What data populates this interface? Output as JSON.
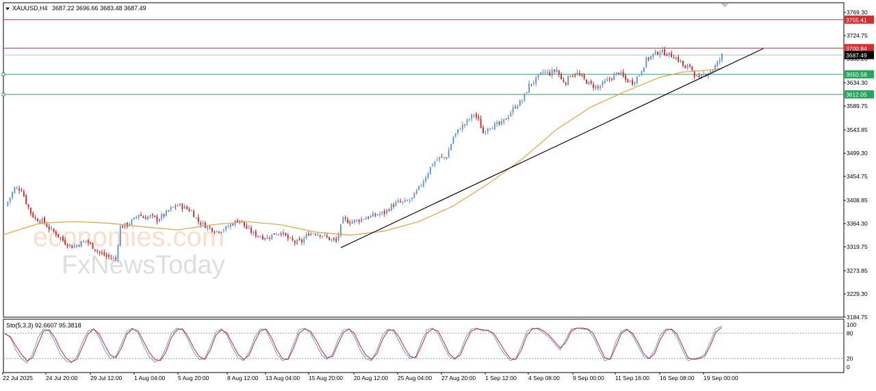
{
  "header": {
    "symbol": "XAUUSD,H4",
    "ohlc": "3687.22 3696.66 3683.48 3687.49"
  },
  "watermark": {
    "line1": "economies.com",
    "line2": "FxNewsToday"
  },
  "chart_data": [
    {
      "type": "candlestick",
      "title": "XAUUSD,H4",
      "ylim": [
        3184.75,
        3780.0
      ],
      "y_ticks": [
        "3769.30",
        "3724.75",
        "3680.20",
        "3634.30",
        "3589.75",
        "3543.85",
        "3499.30",
        "3454.75",
        "3408.85",
        "3364.30",
        "3319.75",
        "3273.85",
        "3229.30",
        "3184.75"
      ],
      "x_labels": [
        "22 Jul 2025",
        "24 Jul 20:00",
        "29 Jul 12:00",
        "1 Aug 04:00",
        "5 Aug 20:00",
        "8 Aug 12:00",
        "13 Aug 04:00",
        "15 Aug 20:00",
        "20 Aug 12:00",
        "25 Aug 04:00",
        "27 Aug 20:00",
        "1 Sep 12:00",
        "4 Sep 08:00",
        "9 Sep 00:00",
        "11 Sep 16:00",
        "16 Sep 08:00",
        "19 Sep 00:00"
      ],
      "last_price": "3687.49",
      "horizontal_levels": [
        {
          "value": 3755.41,
          "label": "3755.41",
          "color": "#d32f2f"
        },
        {
          "value": 3700.84,
          "label": "3700.84",
          "color": "#d32f2f"
        },
        {
          "value": 3650.58,
          "label": "3650.58",
          "color": "#26a65b"
        },
        {
          "value": 3612.05,
          "label": "3612.05",
          "color": "#26a65b"
        }
      ],
      "up_color": "#5b8fd6",
      "down_color": "#cc2222",
      "ma_color": "#e3a23c",
      "trendline_color": "#000000",
      "series": [
        {
          "name": "XAUUSD",
          "close_path": [
            [
              0,
              3398
            ],
            [
              4,
              3432
            ],
            [
              7,
              3430
            ],
            [
              9,
              3405
            ],
            [
              11,
              3385
            ],
            [
              13,
              3373
            ],
            [
              16,
              3370
            ],
            [
              19,
              3355
            ],
            [
              22,
              3345
            ],
            [
              26,
              3328
            ],
            [
              29,
              3320
            ],
            [
              32,
              3325
            ],
            [
              35,
              3332
            ],
            [
              38,
              3320
            ],
            [
              41,
              3308
            ],
            [
              44,
              3302
            ],
            [
              46,
              3298
            ],
            [
              48,
              3296
            ],
            [
              50,
              3358
            ],
            [
              53,
              3362
            ],
            [
              56,
              3372
            ],
            [
              58,
              3383
            ],
            [
              60,
              3376
            ],
            [
              63,
              3378
            ],
            [
              66,
              3372
            ],
            [
              69,
              3381
            ],
            [
              72,
              3392
            ],
            [
              75,
              3400
            ],
            [
              78,
              3395
            ],
            [
              81,
              3388
            ],
            [
              84,
              3368
            ],
            [
              88,
              3358
            ],
            [
              92,
              3350
            ],
            [
              96,
              3355
            ],
            [
              99,
              3365
            ],
            [
              102,
              3372
            ],
            [
              105,
              3355
            ],
            [
              108,
              3345
            ],
            [
              111,
              3340
            ],
            [
              114,
              3337
            ],
            [
              117,
              3345
            ],
            [
              120,
              3348
            ],
            [
              123,
              3335
            ],
            [
              126,
              3328
            ],
            [
              129,
              3330
            ],
            [
              132,
              3346
            ],
            [
              135,
              3347
            ],
            [
              138,
              3342
            ],
            [
              141,
              3335
            ],
            [
              144,
              3330
            ],
            [
              147,
              3372
            ],
            [
              150,
              3368
            ],
            [
              153,
              3370
            ],
            [
              156,
              3375
            ],
            [
              159,
              3378
            ],
            [
              162,
              3382
            ],
            [
              165,
              3385
            ],
            [
              168,
              3398
            ],
            [
              171,
              3405
            ],
            [
              174,
              3405
            ],
            [
              177,
              3412
            ],
            [
              180,
              3432
            ],
            [
              183,
              3455
            ],
            [
              186,
              3480
            ],
            [
              189,
              3490
            ],
            [
              192,
              3492
            ],
            [
              195,
              3530
            ],
            [
              198,
              3548
            ],
            [
              201,
              3560
            ],
            [
              204,
              3575
            ],
            [
              206,
              3562
            ],
            [
              208,
              3538
            ],
            [
              210,
              3550
            ],
            [
              213,
              3552
            ],
            [
              216,
              3556
            ],
            [
              219,
              3572
            ],
            [
              222,
              3590
            ],
            [
              225,
              3600
            ],
            [
              228,
              3630
            ],
            [
              231,
              3640
            ],
            [
              234,
              3655
            ],
            [
              237,
              3652
            ],
            [
              240,
              3660
            ],
            [
              242,
              3640
            ],
            [
              244,
              3636
            ],
            [
              246,
              3650
            ],
            [
              249,
              3652
            ],
            [
              252,
              3640
            ],
            [
              255,
              3630
            ],
            [
              258,
              3625
            ],
            [
              261,
              3635
            ],
            [
              264,
              3645
            ],
            [
              267,
              3655
            ],
            [
              270,
              3640
            ],
            [
              273,
              3635
            ],
            [
              276,
              3650
            ],
            [
              279,
              3678
            ],
            [
              282,
              3688
            ],
            [
              285,
              3695
            ],
            [
              288,
              3690
            ],
            [
              291,
              3685
            ],
            [
              294,
              3675
            ],
            [
              296,
              3660
            ],
            [
              298,
              3668
            ],
            [
              300,
              3650
            ],
            [
              302,
              3640
            ],
            [
              304,
              3650
            ],
            [
              306,
              3655
            ],
            [
              308,
              3660
            ],
            [
              310,
              3672
            ],
            [
              312,
              3687
            ]
          ]
        }
      ],
      "ma_path": [
        [
          0,
          3343
        ],
        [
          15,
          3365
        ],
        [
          30,
          3368
        ],
        [
          45,
          3365
        ],
        [
          60,
          3358
        ],
        [
          75,
          3352
        ],
        [
          90,
          3362
        ],
        [
          105,
          3368
        ],
        [
          120,
          3362
        ],
        [
          135,
          3348
        ],
        [
          150,
          3342
        ],
        [
          165,
          3350
        ],
        [
          180,
          3368
        ],
        [
          195,
          3398
        ],
        [
          210,
          3440
        ],
        [
          225,
          3488
        ],
        [
          240,
          3545
        ],
        [
          255,
          3588
        ],
        [
          270,
          3618
        ],
        [
          285,
          3645
        ],
        [
          295,
          3655
        ],
        [
          305,
          3658
        ],
        [
          312,
          3662
        ]
      ],
      "trendline": {
        "from": [
          146,
          3318
        ],
        "to": [
          330,
          3700
        ]
      },
      "n_bars": 312
    },
    {
      "type": "line",
      "title": "Sto(5,3,3) 92.6607 95.3818",
      "indicator": "Sto(5,3,3)",
      "values_text": "92.6607 95.3818",
      "ylim": [
        0,
        100
      ],
      "y_ticks": [
        "100",
        "80",
        "20",
        "0"
      ],
      "levels": [
        20,
        80
      ],
      "series": [
        {
          "name": "main",
          "color": "#6a9fd8",
          "values": [
            80,
            70,
            40,
            20,
            10,
            30,
            70,
            90,
            85,
            60,
            30,
            15,
            10,
            25,
            60,
            85,
            90,
            70,
            40,
            20,
            25,
            55,
            85,
            92,
            80,
            50,
            25,
            12,
            18,
            45,
            80,
            92,
            88,
            65,
            35,
            18,
            20,
            50,
            82,
            90,
            75,
            45,
            22,
            15,
            35,
            70,
            90,
            88,
            60,
            30,
            15,
            20,
            55,
            88,
            92,
            80,
            55,
            30,
            18,
            30,
            65,
            88,
            90,
            70,
            40,
            20,
            15,
            40,
            75,
            90,
            85,
            60,
            35,
            20,
            25,
            60,
            88,
            92,
            78,
            50,
            25,
            18,
            35,
            70,
            90,
            92,
            85,
            88,
            75,
            50,
            30,
            15,
            20,
            50,
            85,
            92,
            90,
            80,
            70,
            55,
            40,
            65,
            90,
            92,
            90,
            88,
            70,
            40,
            15,
            20,
            60,
            85,
            90,
            75,
            50,
            25,
            20,
            40,
            75,
            90,
            88,
            70,
            40,
            15,
            20,
            22,
            30,
            60,
            90,
            96
          ]
        },
        {
          "name": "signal",
          "color": "#cc2222",
          "values": [
            78,
            72,
            50,
            30,
            15,
            22,
            55,
            85,
            88,
            70,
            42,
            22,
            12,
            18,
            48,
            78,
            90,
            78,
            52,
            28,
            22,
            45,
            78,
            90,
            85,
            60,
            35,
            18,
            15,
            35,
            70,
            88,
            90,
            72,
            45,
            25,
            18,
            40,
            75,
            88,
            80,
            55,
            30,
            18,
            28,
            60,
            85,
            90,
            70,
            40,
            20,
            18,
            45,
            80,
            90,
            85,
            65,
            40,
            22,
            25,
            55,
            82,
            90,
            78,
            50,
            28,
            18,
            32,
            65,
            86,
            88,
            70,
            45,
            25,
            22,
            50,
            80,
            90,
            85,
            60,
            32,
            20,
            28,
            60,
            85,
            90,
            88,
            86,
            80,
            60,
            38,
            20,
            18,
            40,
            75,
            90,
            92,
            85,
            75,
            60,
            45,
            58,
            85,
            92,
            92,
            90,
            78,
            50,
            22,
            18,
            48,
            80,
            88,
            80,
            58,
            32,
            20,
            32,
            65,
            86,
            90,
            78,
            50,
            22,
            18,
            20,
            26,
            50,
            82,
            93
          ]
        }
      ]
    }
  ]
}
